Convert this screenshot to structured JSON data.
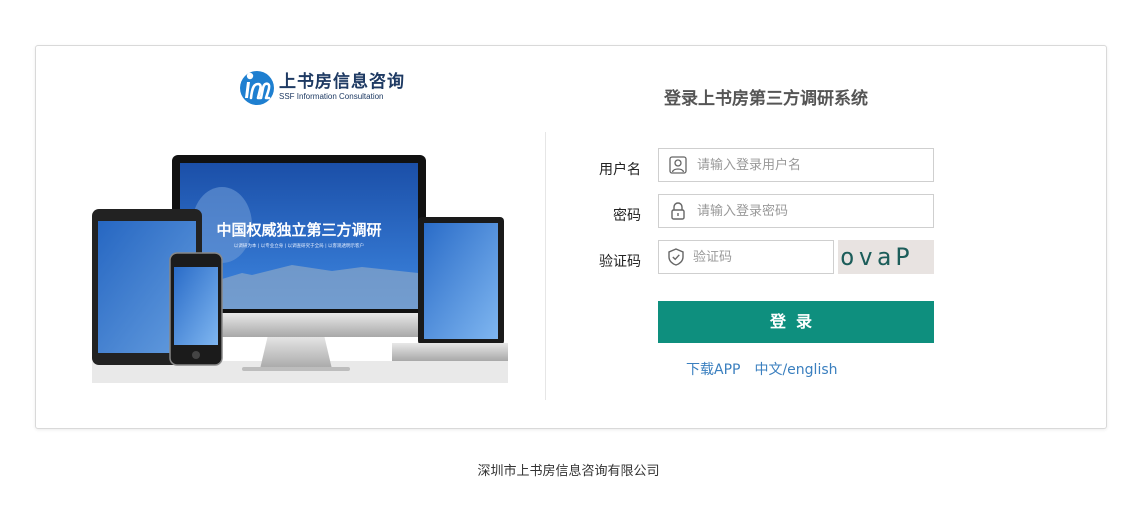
{
  "logo": {
    "name_cn": "上书房信息咨询",
    "name_en": "SSF Information Consultation",
    "icon": "ssf-logo-mark"
  },
  "hero": {
    "headline": "中国权威独立第三方调研",
    "tagline": "以调研为本 | 以专业立身 | 以调查研究于全局 | 以客观透明示客户"
  },
  "login": {
    "title": "登录上书房第三方调研系统",
    "username": {
      "label": "用户名",
      "placeholder": "请输入登录用户名",
      "value": "",
      "icon": "user-icon"
    },
    "password": {
      "label": "密码",
      "placeholder": "请输入登录密码",
      "value": "",
      "icon": "lock-icon"
    },
    "captcha": {
      "label": "验证码",
      "placeholder": "验证码",
      "value": "",
      "icon": "shield-check-icon",
      "code": "ovaP"
    },
    "submit_label": "登录",
    "links": {
      "download": "下载APP",
      "lang": "中文/english"
    }
  },
  "footer": {
    "company": "深圳市上书房信息咨询有限公司"
  },
  "colors": {
    "primary": "#0e8f7e",
    "link": "#3a7fbf",
    "brand": "#1e7fd0"
  }
}
